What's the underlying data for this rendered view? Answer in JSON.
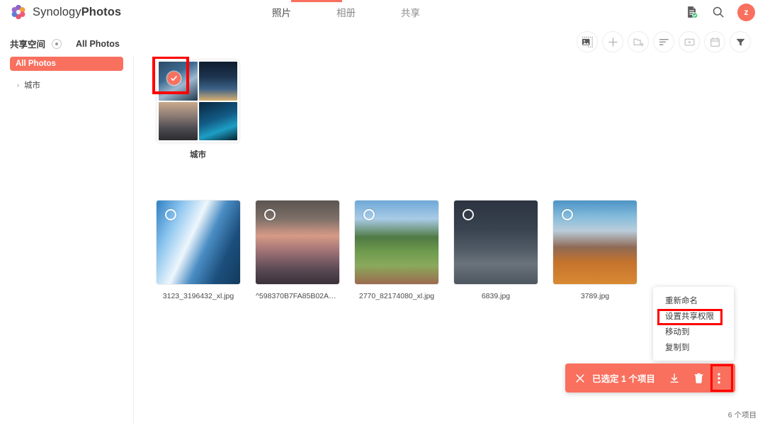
{
  "app": {
    "brand_prefix": "Synology",
    "brand_suffix": "Photos",
    "logo_icon": "synology-photos-logo-icon"
  },
  "header": {
    "tabs": [
      {
        "label": "照片",
        "active": true
      },
      {
        "label": "相册",
        "active": false
      },
      {
        "label": "共享",
        "active": false
      }
    ],
    "actions": [
      {
        "name": "backup-status-icon",
        "label": "backup-status-icon"
      },
      {
        "name": "search-icon",
        "label": "search-icon"
      }
    ],
    "avatar_initial": "z",
    "accent_color": "#f9705e"
  },
  "breadcrumb": {
    "space_label": "共享空间",
    "dropdown_icon": "chevron-dot-icon",
    "current_label": "All Photos"
  },
  "toolbar": {
    "buttons": [
      {
        "name": "select-mode-icon",
        "title": "select-mode"
      },
      {
        "name": "plus-icon",
        "title": "add"
      },
      {
        "name": "new-folder-icon",
        "title": "new-folder"
      },
      {
        "name": "sort-icon",
        "title": "sort"
      },
      {
        "name": "slideshow-icon",
        "title": "slideshow"
      },
      {
        "name": "calendar-icon",
        "title": "calendar"
      },
      {
        "name": "filter-icon",
        "title": "filter"
      }
    ]
  },
  "sidebar": {
    "items": [
      {
        "label": "All Photos",
        "selected": true
      },
      {
        "label": "城市",
        "selected": false,
        "caret": "›"
      }
    ]
  },
  "folder": {
    "label": "城市",
    "selected": true,
    "check_icon": "check-circle-icon"
  },
  "photos": [
    {
      "filename": "3123_3196432_xl.jpg",
      "selected": false
    },
    {
      "filename": "^598370B7FA85B02A310…",
      "selected": false
    },
    {
      "filename": "2770_82174080_xl.jpg",
      "selected": false
    },
    {
      "filename": "6839.jpg",
      "selected": false
    },
    {
      "filename": "3789.jpg",
      "selected": false
    }
  ],
  "context_menu": {
    "items": [
      {
        "label": "重新命名",
        "highlighted": false
      },
      {
        "label": "设置共享权限",
        "highlighted": true
      },
      {
        "label": "移动到",
        "highlighted": false
      },
      {
        "label": "复制到",
        "highlighted": false
      }
    ]
  },
  "action_bar": {
    "close_icon": "close-icon",
    "selection_label": "已选定 1 个项目",
    "download_icon": "download-icon",
    "delete_icon": "trash-icon",
    "more_icon": "kebab-menu-icon",
    "background_color": "#f9705e"
  },
  "status": {
    "item_count_label": "6 个项目"
  },
  "annotations": {
    "highlight_color": "#ff0000",
    "boxes": [
      "folder-thumbnail-selection",
      "context-menu-share-permission",
      "action-bar-kebab"
    ]
  }
}
